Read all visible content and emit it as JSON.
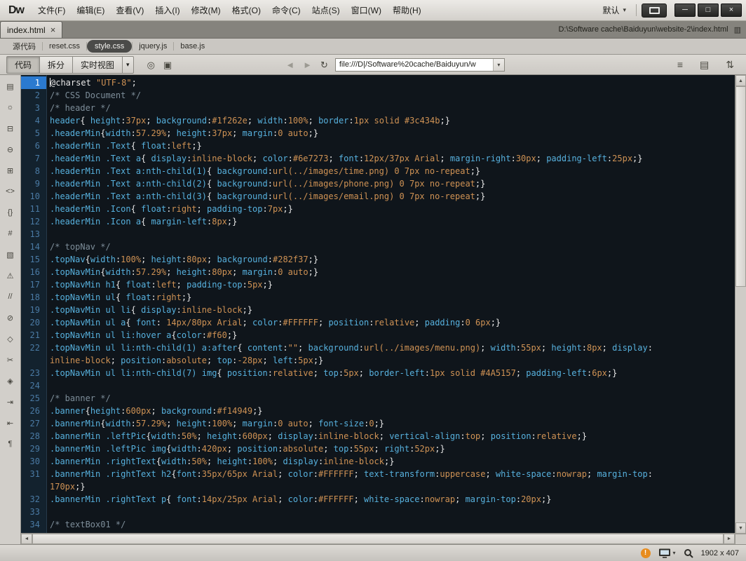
{
  "window": {
    "logo": "Dw",
    "menus": [
      "文件(F)",
      "编辑(E)",
      "查看(V)",
      "插入(I)",
      "修改(M)",
      "格式(O)",
      "命令(C)",
      "站点(S)",
      "窗口(W)",
      "帮助(H)"
    ],
    "workspace_label": "默认",
    "minimize_glyph": "─",
    "maximize_glyph": "□",
    "close_glyph": "×"
  },
  "tabbar": {
    "active_tab": "index.html",
    "tab_close_glyph": "×",
    "file_path": "D:\\Software cache\\Baiduyun\\website-2\\index.html"
  },
  "related_files": {
    "items": [
      {
        "label": "源代码",
        "active": false
      },
      {
        "label": "reset.css",
        "active": false
      },
      {
        "label": "style.css",
        "active": true
      },
      {
        "label": "jquery.js",
        "active": false
      },
      {
        "label": "base.js",
        "active": false
      }
    ]
  },
  "toolbar": {
    "code_button": "代码",
    "split_button": "拆分",
    "live_button": "实时视图",
    "address_value": "file:///D|/Software%20cache/Baiduyun/w"
  },
  "icons": {
    "dropdown": "▾",
    "live_code": "◎",
    "inspect": "▣",
    "back": "◄",
    "forward": "►",
    "refresh": "↻",
    "format_options": "≡",
    "panel_grid": "▤",
    "sort": "⇅",
    "tab_list": "▥",
    "up": "▲",
    "down": "▼",
    "left": "◄",
    "right": "►"
  },
  "status_bar": {
    "warning_glyph": "!",
    "window_size": "1902 x 407"
  },
  "colors": {
    "editor_bg": "#0f151b",
    "gutter_bg": "#13222e",
    "gutter_border": "#26394a",
    "line_number": "#4a7aa4",
    "active_line_bg": "#2b7ad0",
    "selector": "#57b1de",
    "value": "#cf9254",
    "punctuation": "#e8e8e8",
    "comment": "#7d8d99",
    "warning": "#e78c1e"
  },
  "editor": {
    "active_line": 1,
    "coding_toolbar_icons": [
      {
        "name": "open-documents-icon",
        "glyph": "▤"
      },
      {
        "name": "code-navigator-icon",
        "glyph": "☼"
      },
      {
        "name": "collapse-full-tag-icon",
        "glyph": "⊟"
      },
      {
        "name": "collapse-selection-icon",
        "glyph": "⊖"
      },
      {
        "name": "expand-all-icon",
        "glyph": "⊞"
      },
      {
        "name": "select-parent-tag-icon",
        "glyph": "<>"
      },
      {
        "name": "balance-braces-icon",
        "glyph": "{}"
      },
      {
        "name": "line-numbers-icon",
        "glyph": "#"
      },
      {
        "name": "highlight-invalid-code-icon",
        "glyph": "▧"
      },
      {
        "name": "syntax-error-alerts-icon",
        "glyph": "⚠"
      },
      {
        "name": "apply-comment-icon",
        "glyph": "//"
      },
      {
        "name": "remove-comment-icon",
        "glyph": "⊘"
      },
      {
        "name": "wrap-tag-icon",
        "glyph": "◇"
      },
      {
        "name": "recent-snippets-icon",
        "glyph": "✂"
      },
      {
        "name": "move-convert-css-icon",
        "glyph": "◈"
      },
      {
        "name": "indent-code-icon",
        "glyph": "⇥"
      },
      {
        "name": "outdent-code-icon",
        "glyph": "⇤"
      },
      {
        "name": "format-source-code-icon",
        "glyph": "¶"
      }
    ],
    "lines": [
      "@charset \"UTF-8\";",
      "/* CSS Document */",
      "/* header */",
      "header{ height:37px; background:#1f262e; width:100%; border:1px solid #3c434b;}",
      ".headerMin{width:57.29%; height:37px; margin:0 auto;}",
      ".headerMin .Text{ float:left;}",
      ".headerMin .Text a{ display:inline-block; color:#6e7273; font:12px/37px Arial; margin-right:30px; padding-left:25px;}",
      ".headerMin .Text a:nth-child(1){ background:url(../images/time.png) 0 7px no-repeat;}",
      ".headerMin .Text a:nth-child(2){ background:url(../images/phone.png) 0 7px no-repeat;}",
      ".headerMin .Text a:nth-child(3){ background:url(../images/email.png) 0 7px no-repeat;}",
      ".headerMin .Icon{ float:right; padding-top:7px;}",
      ".headerMin .Icon a{ margin-left:8px;}",
      "",
      "/* topNav */",
      ".topNav{width:100%; height:80px; background:#282f37;}",
      ".topNavMin{width:57.29%; height:80px; margin:0 auto;}",
      ".topNavMin h1{ float:left; padding-top:5px;}",
      ".topNavMin ul{ float:right;}",
      ".topNavMin ul li{ display:inline-block;}",
      ".topNavMin ul a{ font: 14px/80px Arial; color:#FFFFFF; position:relative; padding:0 6px;}",
      ".topNavMin ul li:hover a{color:#f60;}",
      ".topNavMin ul li:nth-child(1) a:after{ content:\"\"; background:url(../images/menu.png); width:55px; height:8px; display: inline-block; position:absolute; top:-28px; left:5px;}",
      ".topNavMin ul li:nth-child(7) img{ position:relative; top:5px; border-left:1px solid #4A5157; padding-left:6px;}",
      "",
      "/* banner */",
      ".banner{height:600px; background:#f14949;}",
      ".bannerMin{width:57.29%; height:100%; margin:0 auto; font-size:0;}",
      ".bannerMin .leftPic{width:50%; height:600px; display:inline-block; vertical-align:top; position:relative;}",
      ".bannerMin .leftPic img{width:420px; position:absolute; top:55px; right:52px;}",
      ".bannerMin .rightText{width:50%; height:100%; display:inline-block;}",
      ".bannerMin .rightText h2{font:35px/65px Arial; color:#FFFFFF; text-transform:uppercase; white-space:nowrap; margin-top: 170px;}",
      ".bannerMin .rightText p{ font:14px/25px Arial; color:#FFFFFF; white-space:nowrap; margin-top:20px;}",
      "",
      "/* textBox01 */"
    ]
  }
}
